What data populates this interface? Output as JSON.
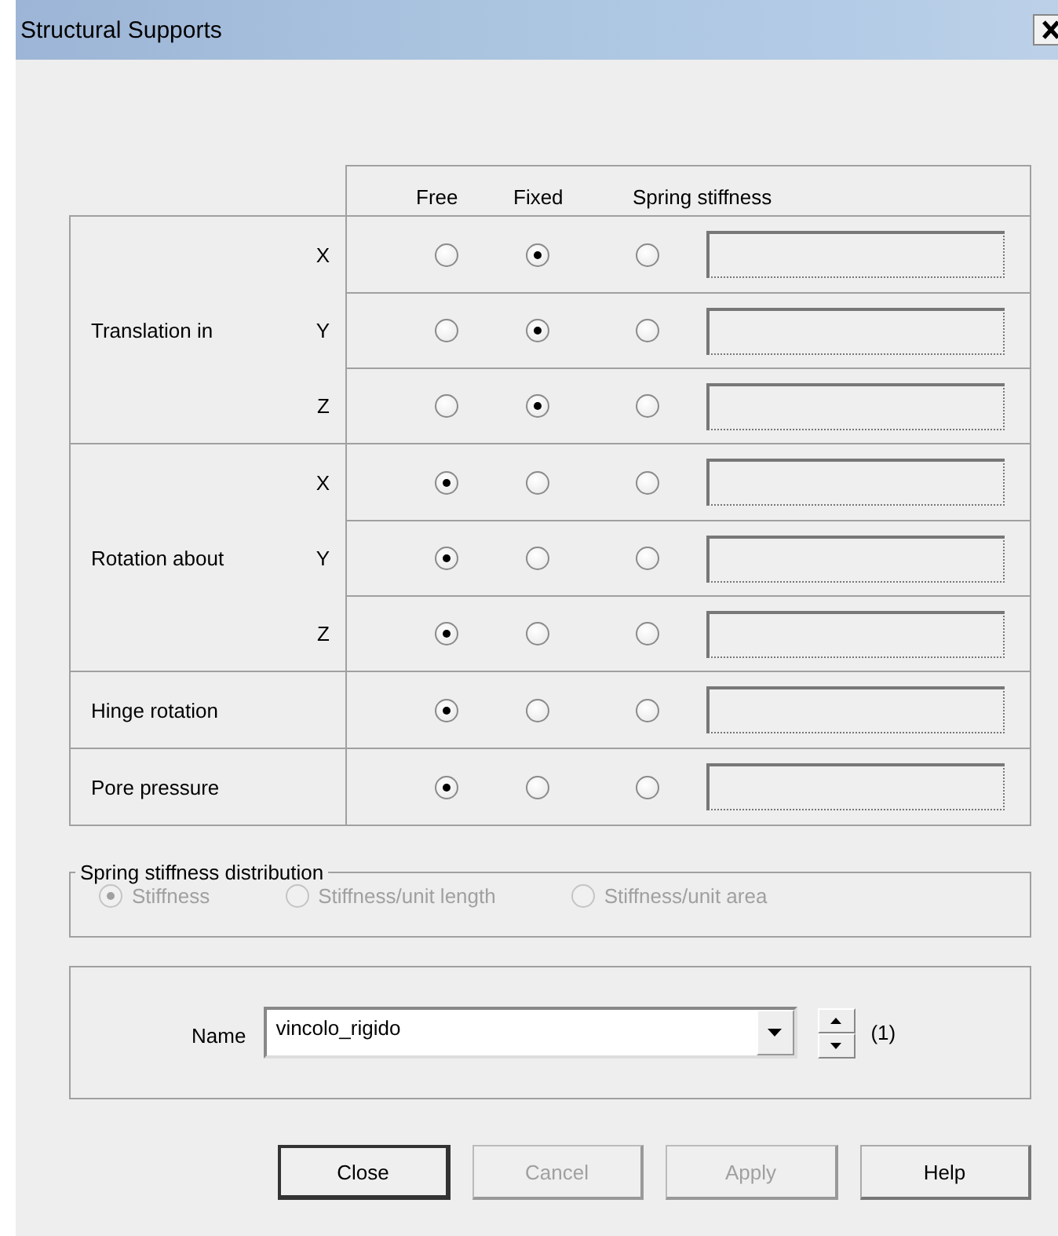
{
  "window": {
    "title": "Structural Supports"
  },
  "columns": [
    "Free",
    "Fixed",
    "Spring stiffness"
  ],
  "sections": [
    {
      "label": "Translation in",
      "rows": [
        {
          "axis": "X",
          "options": [
            {
              "selected": false
            },
            {
              "selected": true
            },
            {
              "selected": false
            }
          ]
        },
        {
          "axis": "Y",
          "options": [
            {
              "selected": false
            },
            {
              "selected": true
            },
            {
              "selected": false
            }
          ]
        },
        {
          "axis": "Z",
          "options": [
            {
              "selected": false
            },
            {
              "selected": true
            },
            {
              "selected": false
            }
          ]
        }
      ]
    },
    {
      "label": "Rotation about",
      "rows": [
        {
          "axis": "X",
          "options": [
            {
              "selected": true
            },
            {
              "selected": false
            },
            {
              "selected": false
            }
          ]
        },
        {
          "axis": "Y",
          "options": [
            {
              "selected": true
            },
            {
              "selected": false
            },
            {
              "selected": false
            }
          ]
        },
        {
          "axis": "Z",
          "options": [
            {
              "selected": true
            },
            {
              "selected": false
            },
            {
              "selected": false
            }
          ]
        }
      ]
    },
    {
      "label": "Hinge rotation",
      "rows": [
        {
          "options": [
            {
              "selected": true
            },
            {
              "selected": false
            },
            {
              "selected": false
            }
          ]
        }
      ]
    },
    {
      "label": "Pore pressure",
      "rows": [
        {
          "options": [
            {
              "selected": true
            },
            {
              "selected": false
            },
            {
              "selected": false
            }
          ]
        }
      ]
    }
  ],
  "distribution": {
    "title": "Spring stiffness distribution",
    "disabled": true,
    "options": [
      {
        "label": "Stiffness",
        "selected": true
      },
      {
        "label": "Stiffness/unit length",
        "selected": false
      },
      {
        "label": "Stiffness/unit area",
        "selected": false
      }
    ]
  },
  "name": {
    "label": "Name",
    "value": "vincolo_rigido",
    "counter": "(1)"
  },
  "buttons": [
    {
      "label": "Close",
      "disabled": false
    },
    {
      "label": "Cancel",
      "disabled": true
    },
    {
      "label": "Apply",
      "disabled": true
    },
    {
      "label": "Help",
      "disabled": false
    }
  ]
}
